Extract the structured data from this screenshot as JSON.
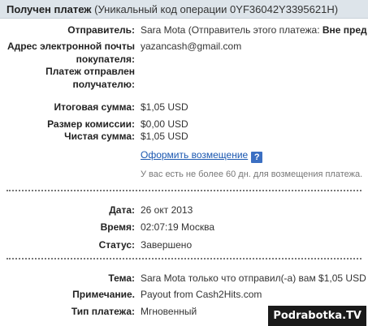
{
  "header": {
    "title": "Получен платеж",
    "operation_code": "(Уникальный код операции 0YF36042Y3395621H)"
  },
  "details": {
    "sender_label": "Отправитель:",
    "sender_value": "Sara Mota (Отправитель этого платежа: ",
    "sender_value_bold": "Вне пред",
    "email_label_line1": "Адрес электронной почты",
    "email_label_line2": "покупателя:",
    "email_value": "yazancash@gmail.com",
    "paid_to_label_line1": "Платеж отправлен",
    "paid_to_label_line2": "получателю:"
  },
  "amounts": {
    "total_label": "Итоговая сумма:",
    "total_value": "$1,05 USD",
    "fee_label": "Размер комиссии:",
    "fee_value": "$0,00 USD",
    "net_label": "Чистая сумма:",
    "net_value": "$1,05 USD",
    "refund_link": "Оформить возмещение",
    "help_icon": "?",
    "refund_note": "У вас есть не более 60 дн. для возмещения платежа."
  },
  "status": {
    "date_label": "Дата:",
    "date_value": "26 окт 2013",
    "time_label": "Время:",
    "time_value": "02:07:19 Москва",
    "status_label": "Статус:",
    "status_value": "Завершено"
  },
  "message": {
    "subject_label": "Тема:",
    "subject_value": "Sara Mota только что отправил(-а) вам $1,05 USD",
    "note_label": "Примечание.",
    "note_value": "Payout from Cash2Hits.com",
    "type_label": "Тип платежа:",
    "type_value": "Мгновенный"
  },
  "watermark": "Podrabotka.TV"
}
